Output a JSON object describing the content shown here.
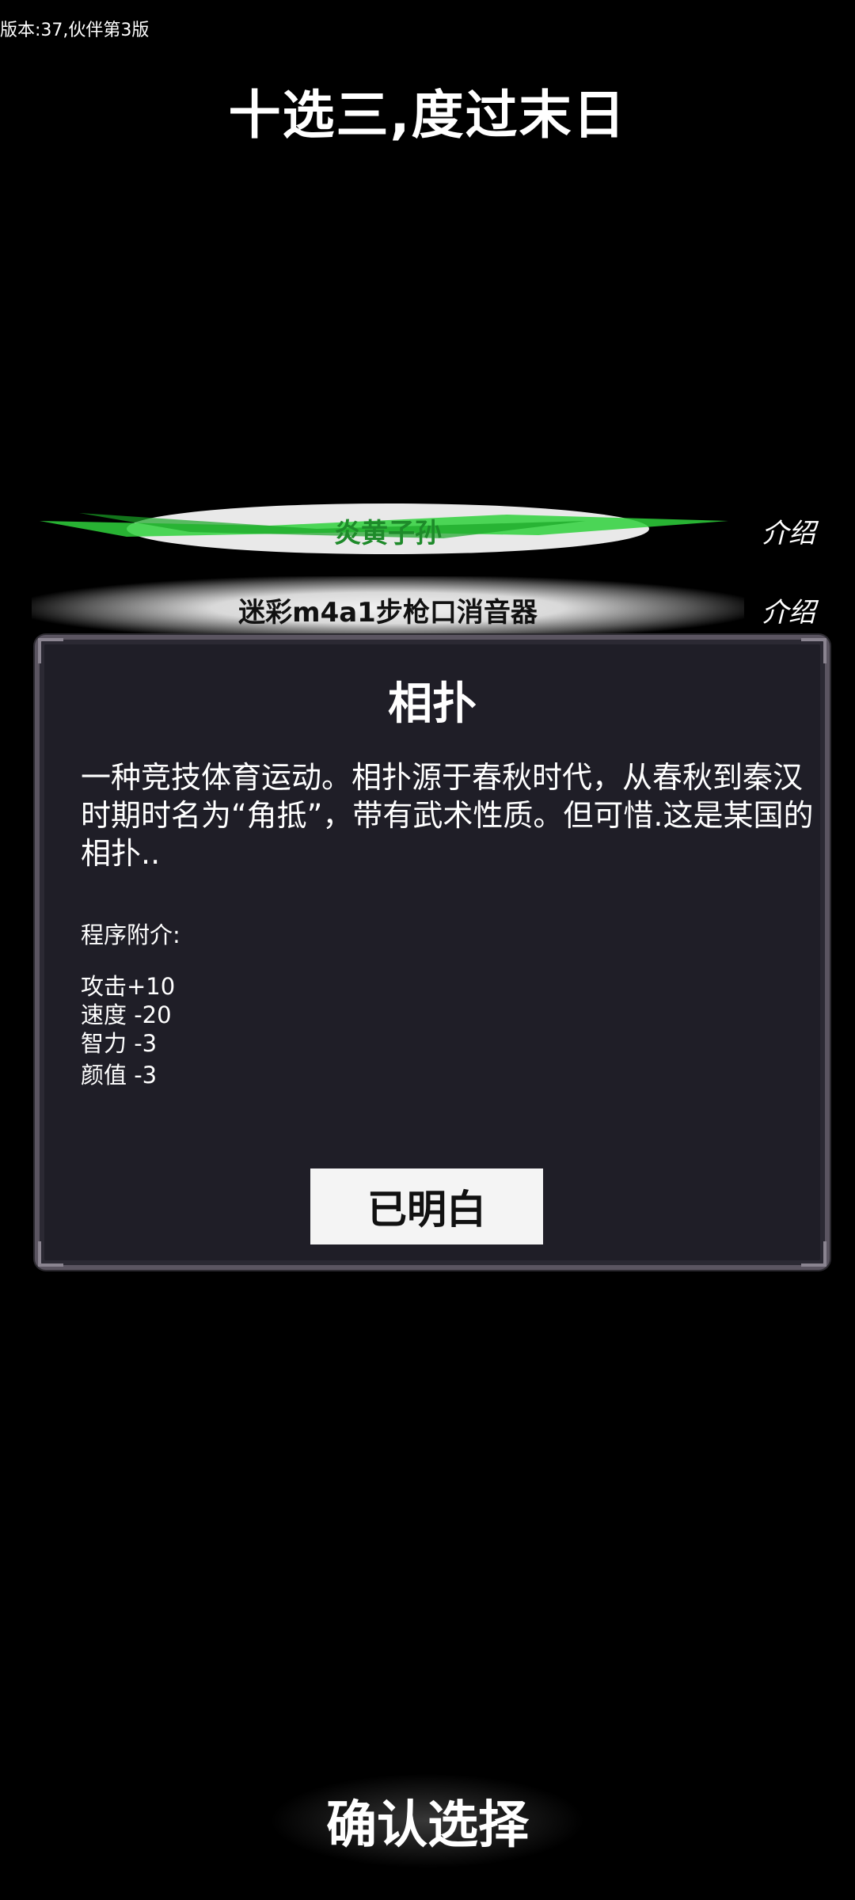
{
  "version_text": "版本:37,伙伴第3版",
  "title": "十选三,度过末日",
  "options": [
    {
      "name": "炎黄子孙",
      "intro": "介绍"
    },
    {
      "name": "迷彩m4a1步枪口消音器",
      "intro": "介绍"
    }
  ],
  "panel": {
    "title": "相扑",
    "description": "一种竞技体育运动。相扑源于春秋时代，从春秋到秦汉时期时名为“角抵”，带有武术性质。但可惜.这是某国的相扑..",
    "note_label": "程序附介:",
    "stats": [
      "攻击+10",
      "速度 -20",
      "智力 -3",
      "颜值 -3"
    ],
    "ok_button": "已明白"
  },
  "confirm_button": "确认选择",
  "colors": {
    "green_highlight": "#1e8a2a",
    "panel_bg": "#1f1e27"
  }
}
